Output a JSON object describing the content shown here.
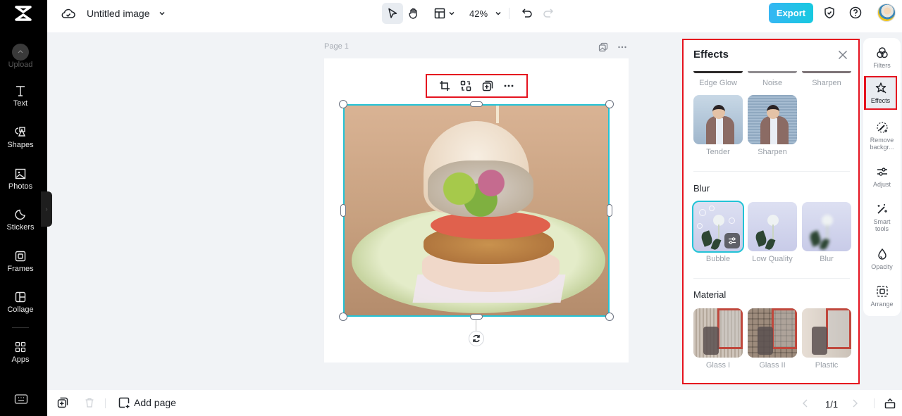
{
  "app": {
    "document_title": "Untitled image",
    "zoom_level": "42%"
  },
  "left_rail": {
    "items": [
      {
        "label": "Upload",
        "icon": "upload-icon",
        "dimmed": true
      },
      {
        "label": "Text",
        "icon": "text-icon"
      },
      {
        "label": "Shapes",
        "icon": "shapes-icon"
      },
      {
        "label": "Photos",
        "icon": "photos-icon"
      },
      {
        "label": "Stickers",
        "icon": "stickers-icon"
      },
      {
        "label": "Frames",
        "icon": "frames-icon"
      },
      {
        "label": "Collage",
        "icon": "collage-icon"
      },
      {
        "label": "Apps",
        "icon": "apps-icon"
      }
    ]
  },
  "topbar": {
    "export_label": "Export"
  },
  "canvas": {
    "page_label": "Page 1",
    "image_subject": "veggie burger on green plate with bubble blur effect"
  },
  "effects_panel": {
    "title": "Effects",
    "partial_row": [
      {
        "label": "Edge Glow"
      },
      {
        "label": "Noise"
      },
      {
        "label": "Sharpen"
      }
    ],
    "top_items": [
      {
        "label": "Tender"
      },
      {
        "label": "Sharpen"
      }
    ],
    "sections": [
      {
        "title": "Blur",
        "items": [
          {
            "label": "Bubble",
            "selected": true
          },
          {
            "label": "Low Quality"
          },
          {
            "label": "Blur"
          }
        ]
      },
      {
        "title": "Material",
        "items": [
          {
            "label": "Glass I"
          },
          {
            "label": "Glass II"
          },
          {
            "label": "Plastic"
          }
        ]
      }
    ]
  },
  "right_rail": {
    "items": [
      {
        "label": "Filters"
      },
      {
        "label": "Effects",
        "active": true
      },
      {
        "label": "Remove backgr..."
      },
      {
        "label": "Adjust"
      },
      {
        "label": "Smart tools"
      },
      {
        "label": "Opacity"
      },
      {
        "label": "Arrange"
      }
    ]
  },
  "bottombar": {
    "add_page_label": "Add page",
    "page_indicator": "1/1"
  },
  "colors": {
    "accent": "#22c3d6",
    "export_gradient_start": "#35b6f3",
    "export_gradient_end": "#17c9e0",
    "highlight_red": "#e5131f"
  }
}
